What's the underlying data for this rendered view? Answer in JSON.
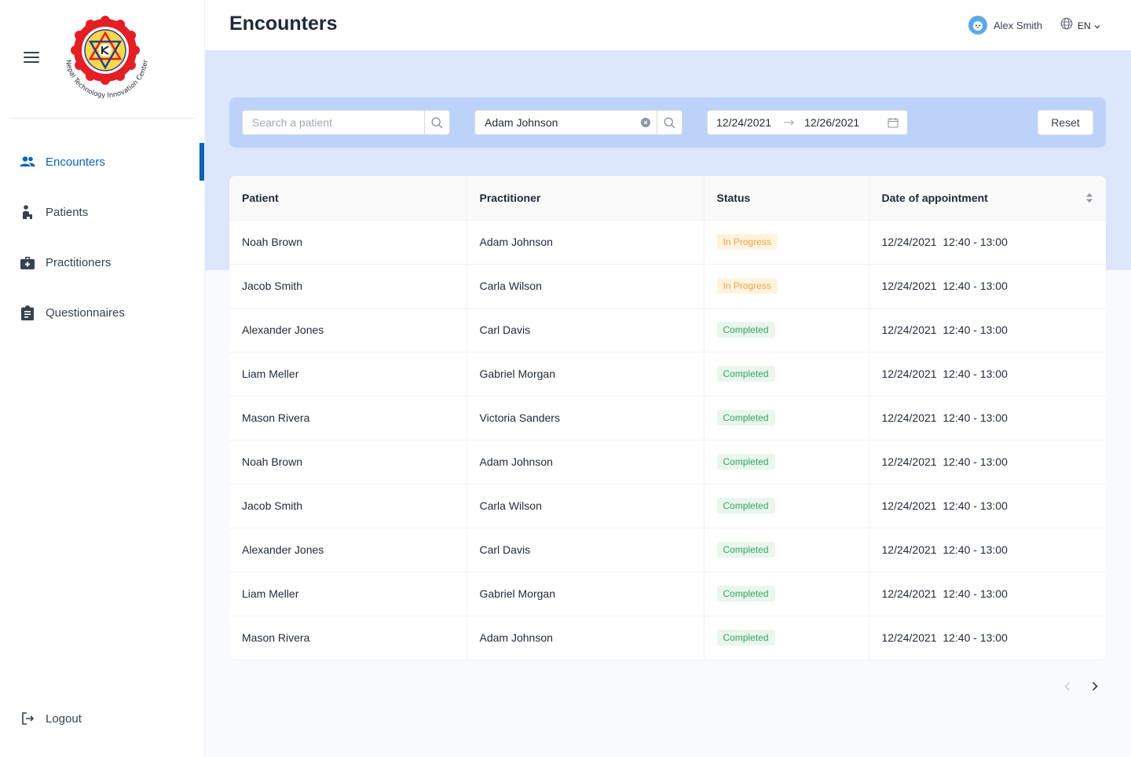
{
  "app": {
    "logo_text": "Nepal Technology Innovation Center"
  },
  "sidebar": {
    "items": [
      {
        "label": "Encounters",
        "icon": "people-icon",
        "active": true
      },
      {
        "label": "Patients",
        "icon": "patient-icon",
        "active": false
      },
      {
        "label": "Practitioners",
        "icon": "medical-kit-icon",
        "active": false
      },
      {
        "label": "Questionnaires",
        "icon": "clipboard-icon",
        "active": false
      }
    ],
    "logout_label": "Logout"
  },
  "header": {
    "title": "Encounters",
    "user_name": "Alex Smith",
    "language": "EN"
  },
  "filters": {
    "patient_search_placeholder": "Search a patient",
    "patient_search_value": "",
    "practitioner_search_value": "Adam Johnson",
    "date_from": "12/24/2021",
    "date_to": "12/26/2021",
    "reset_label": "Reset"
  },
  "table": {
    "columns": [
      "Patient",
      "Practitioner",
      "Status",
      "Date of appointment"
    ],
    "rows": [
      {
        "patient": "Noah Brown",
        "practitioner": "Adam Johnson",
        "status": "In Progress",
        "date": "12/24/2021  12:40 - 13:00"
      },
      {
        "patient": "Jacob Smith",
        "practitioner": "Carla Wilson",
        "status": "In Progress",
        "date": "12/24/2021  12:40 - 13:00"
      },
      {
        "patient": "Alexander Jones",
        "practitioner": "Carl Davis",
        "status": "Completed",
        "date": "12/24/2021  12:40 - 13:00"
      },
      {
        "patient": "Liam Meller",
        "practitioner": "Gabriel Morgan",
        "status": "Completed",
        "date": "12/24/2021  12:40 - 13:00"
      },
      {
        "patient": "Mason Rivera",
        "practitioner": "Victoria Sanders",
        "status": "Completed",
        "date": "12/24/2021  12:40 - 13:00"
      },
      {
        "patient": "Noah Brown",
        "practitioner": "Adam Johnson",
        "status": "Completed",
        "date": "12/24/2021  12:40 - 13:00"
      },
      {
        "patient": "Jacob Smith",
        "practitioner": "Carla Wilson",
        "status": "Completed",
        "date": "12/24/2021  12:40 - 13:00"
      },
      {
        "patient": "Alexander Jones",
        "practitioner": "Carl Davis",
        "status": "Completed",
        "date": "12/24/2021  12:40 - 13:00"
      },
      {
        "patient": "Liam Meller",
        "practitioner": "Gabriel Morgan",
        "status": "Completed",
        "date": "12/24/2021  12:40 - 13:00"
      },
      {
        "patient": "Mason Rivera",
        "practitioner": "Adam Johnson",
        "status": "Completed",
        "date": "12/24/2021  12:40 - 13:00"
      }
    ]
  },
  "colors": {
    "accent": "#0b63b4",
    "band": "#dce7fd",
    "filter_bar": "#bdd2fa",
    "in_progress": "#f0a242",
    "completed": "#3aa45f"
  }
}
